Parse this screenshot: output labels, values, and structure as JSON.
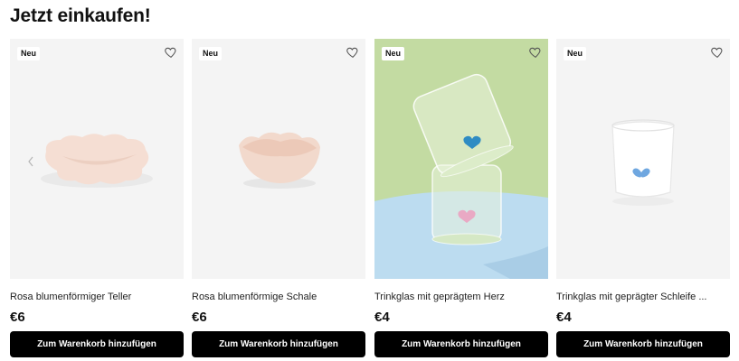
{
  "heading": "Jetzt einkaufen!",
  "products": [
    {
      "badge": "Neu",
      "name": "Rosa blumenförmiger Teller",
      "price": "€6",
      "button": "Zum Warenkorb hinzufügen"
    },
    {
      "badge": "Neu",
      "name": "Rosa blumenförmige Schale",
      "price": "€6",
      "button": "Zum Warenkorb hinzufügen"
    },
    {
      "badge": "Neu",
      "name": "Trinkglas mit geprägtem Herz",
      "price": "€4",
      "button": "Zum Warenkorb hinzufügen"
    },
    {
      "badge": "Neu",
      "name": "Trinkglas mit geprägter Schleife ...",
      "price": "€4",
      "button": "Zum Warenkorb hinzufügen"
    }
  ],
  "colors": {
    "button_bg": "#000000",
    "card_bg": "#f4f4f4",
    "glass_bg": "#c3dba2",
    "table_blue": "#bcdcf0",
    "blush_pink": "#f5ded3"
  },
  "icons": {
    "favorite": "heart-outline-icon",
    "carousel_prev": "chevron-left-icon"
  }
}
